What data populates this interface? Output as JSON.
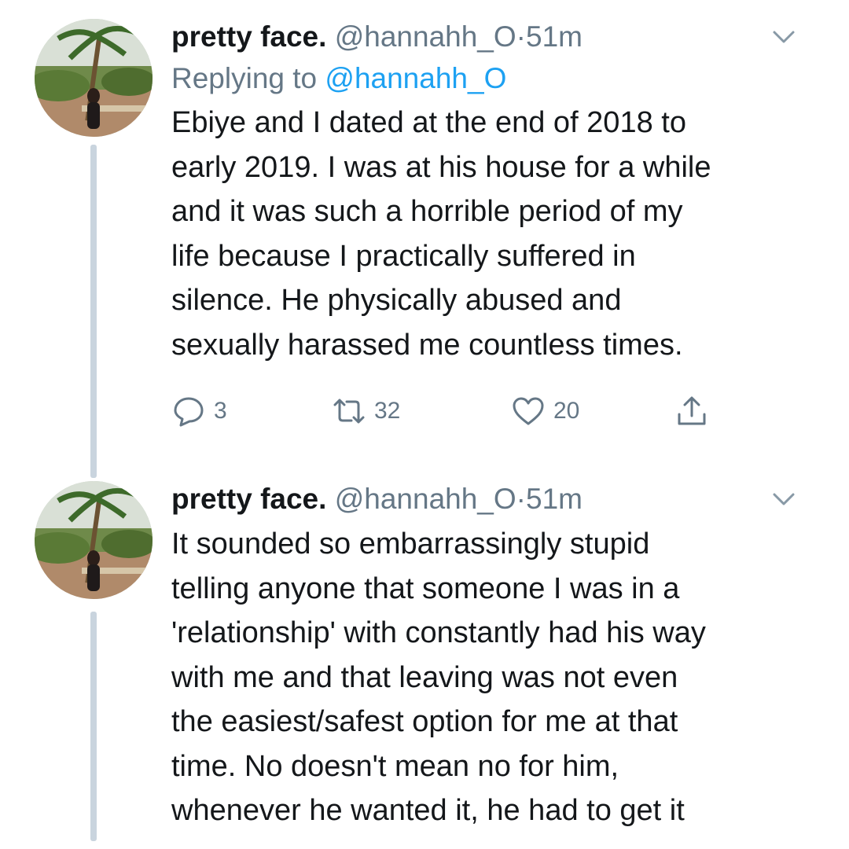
{
  "tweets": [
    {
      "display_name": "pretty face.",
      "handle": "@hannahh_O",
      "separator": "·",
      "time": "51m",
      "replying_prefix": "Replying to",
      "replying_to": "@hannahh_O",
      "text_lines": [
        "Ebiye and I dated at the end of 2018 to",
        "early 2019. I was at his house for a while",
        "and it was such a horrible period of my",
        "life because I practically suffered in",
        "silence. He physically abused and",
        "sexually harassed me countless times."
      ],
      "actions": {
        "reply_count": "3",
        "retweet_count": "32",
        "like_count": "20"
      }
    },
    {
      "display_name": "pretty face.",
      "handle": "@hannahh_O",
      "separator": "·",
      "time": "51m",
      "text_lines": [
        "It sounded so embarrassingly stupid",
        "telling anyone that someone I was in a",
        "'relationship' with constantly had his way",
        "with me and that leaving was not even",
        "the easiest/safest option for me at that",
        "time. No doesn't mean no for him,",
        "whenever he wanted it, he had to get it"
      ]
    }
  ],
  "icons": {
    "reply": "speech-bubble-icon",
    "retweet": "retweet-arrows-icon",
    "like": "heart-icon",
    "share": "share-upload-icon",
    "menu": "chevron-down-icon"
  },
  "colors": {
    "text": "#14171a",
    "secondary": "#657786",
    "link": "#1da1f2",
    "thread_line": "#c9d4de"
  }
}
